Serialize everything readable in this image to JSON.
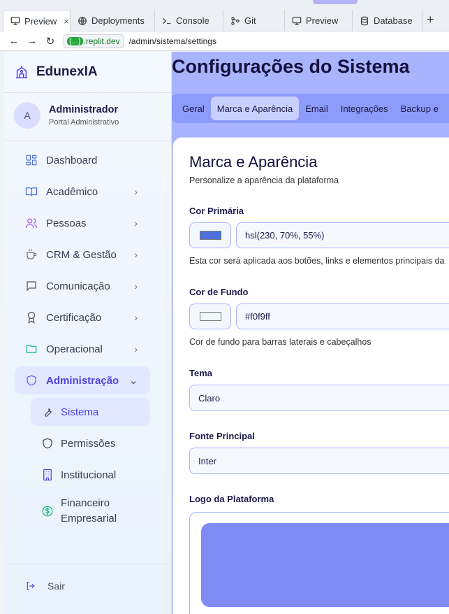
{
  "browser": {
    "tabs": [
      {
        "label": "Preview",
        "icon": "monitor-icon",
        "active": true,
        "close": "×"
      },
      {
        "label": "Deployments",
        "icon": "globe-icon"
      },
      {
        "label": "Console",
        "icon": "terminal-icon"
      },
      {
        "label": "Git",
        "icon": "git-icon"
      },
      {
        "label": "Preview",
        "icon": "monitor-icon"
      },
      {
        "label": "Database",
        "icon": "database-icon"
      }
    ],
    "new_tab": "+",
    "back": "←",
    "forward": "→",
    "reload": "↻",
    "url_blob": "{...}",
    "url_host": ".replit.dev",
    "url_path": "/admin/sistema/settings"
  },
  "sidebar": {
    "brand": "EdunexIA",
    "user": {
      "initial": "A",
      "name": "Administrador",
      "role": "Portal Administrativo"
    },
    "items": [
      {
        "label": "Dashboard",
        "icon": "dashboard-icon"
      },
      {
        "label": "Acadêmico",
        "icon": "book-icon",
        "chevron": "›"
      },
      {
        "label": "Pessoas",
        "icon": "users-icon",
        "chevron": "›"
      },
      {
        "label": "CRM & Gestão",
        "icon": "coffee-icon",
        "chevron": "›"
      },
      {
        "label": "Comunicação",
        "icon": "chat-icon",
        "chevron": "›"
      },
      {
        "label": "Certificação",
        "icon": "award-icon",
        "chevron": "›"
      },
      {
        "label": "Operacional",
        "icon": "folder-icon",
        "chevron": "›"
      },
      {
        "label": "Administração",
        "icon": "shield-icon",
        "chevron": "⌄",
        "active": true
      }
    ],
    "sub_items": [
      {
        "label": "Sistema",
        "icon": "wrench-icon",
        "active": true
      },
      {
        "label": "Permissões",
        "icon": "shield-icon"
      },
      {
        "label": "Institucional",
        "icon": "building-icon"
      },
      {
        "label_line1": "Financeiro",
        "label_line2": "Empresarial",
        "icon": "dollar-icon"
      }
    ],
    "logout": "Sair"
  },
  "main": {
    "title": "Configurações do Sistema",
    "tabs": [
      "Geral",
      "Marca e Aparência",
      "Email",
      "Integrações",
      "Backup e"
    ],
    "active_tab": "Marca e Aparência",
    "card": {
      "title": "Marca e Aparência",
      "subtitle": "Personalize a aparência da plataforma",
      "primary_color": {
        "label": "Cor Primária",
        "value": "hsl(230, 70%, 55%)",
        "swatch": "#4f6fdc",
        "help": "Esta cor será aplicada aos botões, links e elementos principais da"
      },
      "background_color": {
        "label": "Cor de Fundo",
        "value": "#f0f9ff",
        "swatch": "#f0f9ff",
        "help": "Cor de fundo para barras laterais e cabeçalhos"
      },
      "theme": {
        "label": "Tema",
        "value": "Claro"
      },
      "font": {
        "label": "Fonte Principal",
        "value": "Inter"
      },
      "logo": {
        "label": "Logo da Plataforma"
      }
    }
  },
  "colors": {
    "accent": "#4f46e5",
    "main_bg": "#a9b4ff",
    "tabs_bg": "#8d9bfa",
    "logo_preview": "#7f8cf6"
  }
}
